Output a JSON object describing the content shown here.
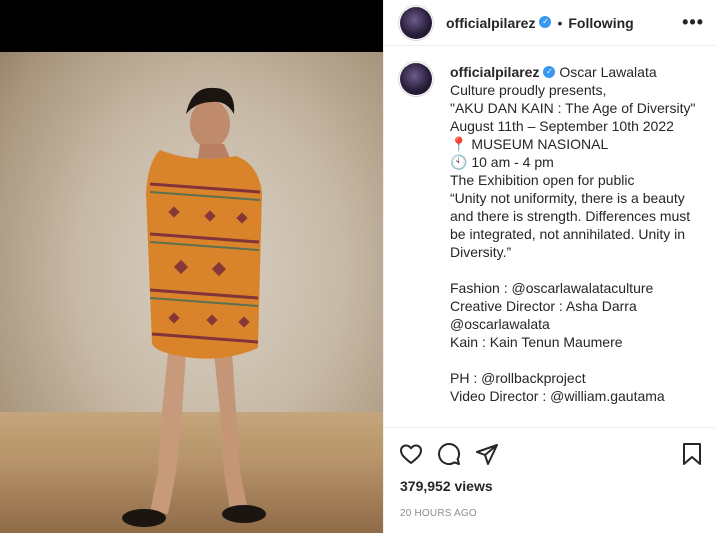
{
  "post": {
    "username": "officialpilarez",
    "follow_dot": "•",
    "follow_label": "Following",
    "more_icon": "more-horizontal-icon",
    "more_label": "•••"
  },
  "caption": {
    "username": "officialpilarez",
    "lines": [
      "Oscar Lawalata Culture proudly presents,",
      "\"AKU DAN KAIN : The Age of Diversity\"",
      "August 11th – September 10th 2022",
      "📍 MUSEUM NASIONAL",
      "🕙 10 am - 4 pm",
      "The Exhibition open for public",
      "“Unity not uniformity, there is a beauty and there is strength. Differences must be integrated, not annihilated. Unity in Diversity.”",
      "",
      "Fashion : @oscarlawalataculture",
      "Creative Director : Asha Darra @oscarlawalata",
      "Kain : Kain Tenun Maumere",
      "",
      "PH : @rollbackproject",
      "Video Director : @william.gautama"
    ]
  },
  "actions": {
    "like_icon": "heart-icon",
    "comment_icon": "comment-icon",
    "share_icon": "send-icon",
    "save_icon": "bookmark-icon"
  },
  "stats": {
    "views": "379,952 views",
    "time_ago": "20 HOURS AGO"
  },
  "colors": {
    "verified": "#3897f0",
    "text": "#262626",
    "muted": "#8e8e8e",
    "fabric": "#d9832b"
  }
}
